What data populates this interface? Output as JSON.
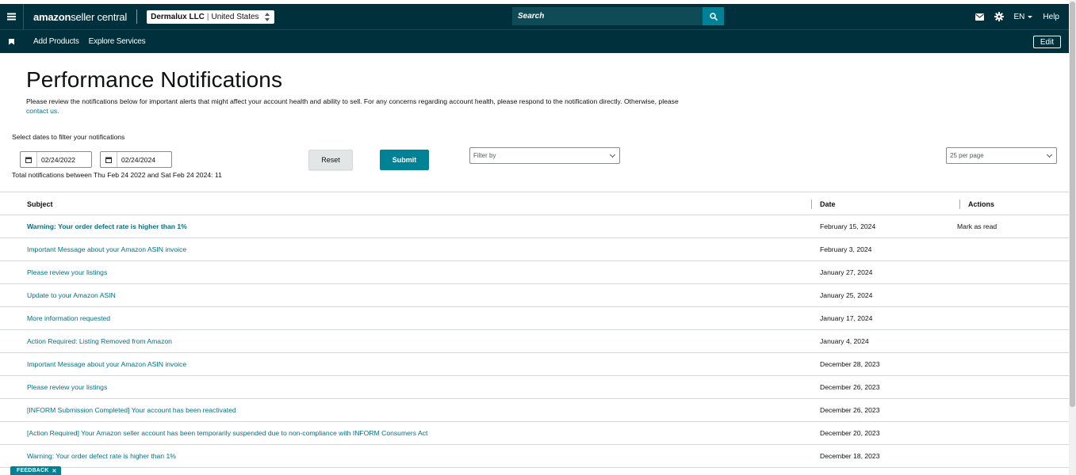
{
  "header": {
    "logo_brand": "amazon",
    "logo_suffix": " seller central",
    "store_name": "Dermalux LLC",
    "store_sep": "|",
    "store_region": "United States",
    "search_placeholder": "Search",
    "language": "EN",
    "help_label": "Help",
    "icons": [
      "menu-icon",
      "mail-icon",
      "gear-icon",
      "search-icon"
    ]
  },
  "nav": {
    "items": [
      "Add Products",
      "Explore Services"
    ],
    "edit_label": "Edit"
  },
  "page": {
    "title": "Performance Notifications",
    "intro": "Please review the notifications below for important alerts that might affect your account health and ability to sell. For any concerns regarding account health, please respond to the notification directly. Otherwise, please",
    "contact_link": "contact us.",
    "filter_label": "Select dates to filter your notifications",
    "start_date": "02/24/2022",
    "end_date": "02/24/2024",
    "total_text": "Total notifications between Thu Feb 24 2022 and Sat Feb 24 2024: 11",
    "reset_label": "Reset",
    "submit_label": "Submit",
    "filter_placeholder": "Filter by",
    "per_page": "25 per page"
  },
  "table": {
    "headers": {
      "subject": "Subject",
      "date": "Date",
      "actions": "Actions"
    },
    "rows": [
      {
        "subject": "Warning: Your order defect rate is higher than 1%",
        "date": "February 15, 2024",
        "action": "Mark as read",
        "unread": true
      },
      {
        "subject": "Important Message about your Amazon ASIN invoice",
        "date": "February 3, 2024",
        "action": "",
        "unread": false
      },
      {
        "subject": "Please review your listings",
        "date": "January 27, 2024",
        "action": "",
        "unread": false
      },
      {
        "subject": "Update to your Amazon ASIN",
        "date": "January 25, 2024",
        "action": "",
        "unread": false
      },
      {
        "subject": "More information requested",
        "date": "January 17, 2024",
        "action": "",
        "unread": false
      },
      {
        "subject": "Action Required: Listing Removed from Amazon",
        "date": "January 4, 2024",
        "action": "",
        "unread": false
      },
      {
        "subject": "Important Message about your Amazon ASIN invoice",
        "date": "December 28, 2023",
        "action": "",
        "unread": false
      },
      {
        "subject": "Please review your listings",
        "date": "December 26, 2023",
        "action": "",
        "unread": false
      },
      {
        "subject": "[INFORM Submission Completed] Your account has been reactivated",
        "date": "December 26, 2023",
        "action": "",
        "unread": false
      },
      {
        "subject": "[Action Required] Your Amazon seller account has been temporarily suspended due to non-compliance with INFORM Consumers Act",
        "date": "December 20, 2023",
        "action": "",
        "unread": false
      },
      {
        "subject": "Warning: Your order defect rate is higher than 1%",
        "date": "December 18, 2023",
        "action": "",
        "unread": false
      }
    ]
  },
  "feedback": {
    "label": "FEEDBACK",
    "close": "✕"
  },
  "colors": {
    "header_bg": "#00303b",
    "accent": "#008296",
    "link": "#007185"
  }
}
